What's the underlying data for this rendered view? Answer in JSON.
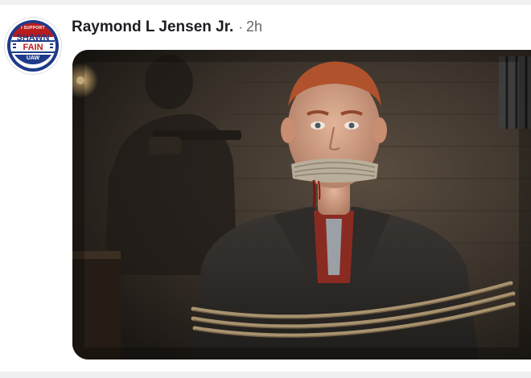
{
  "post": {
    "author": {
      "name": "Raymond L Jensen Jr.",
      "avatar": {
        "support_text": "I SUPPORT",
        "first_name": "SHAWN",
        "last_name": "FAIN",
        "union": "UAW",
        "colors": {
          "navy": "#1e3a8a",
          "red": "#b91c1c"
        }
      }
    },
    "separator": "·",
    "time_ago": "2h",
    "media": {
      "type": "photo",
      "subject_icon": "photo-gagged-bound-man"
    }
  }
}
